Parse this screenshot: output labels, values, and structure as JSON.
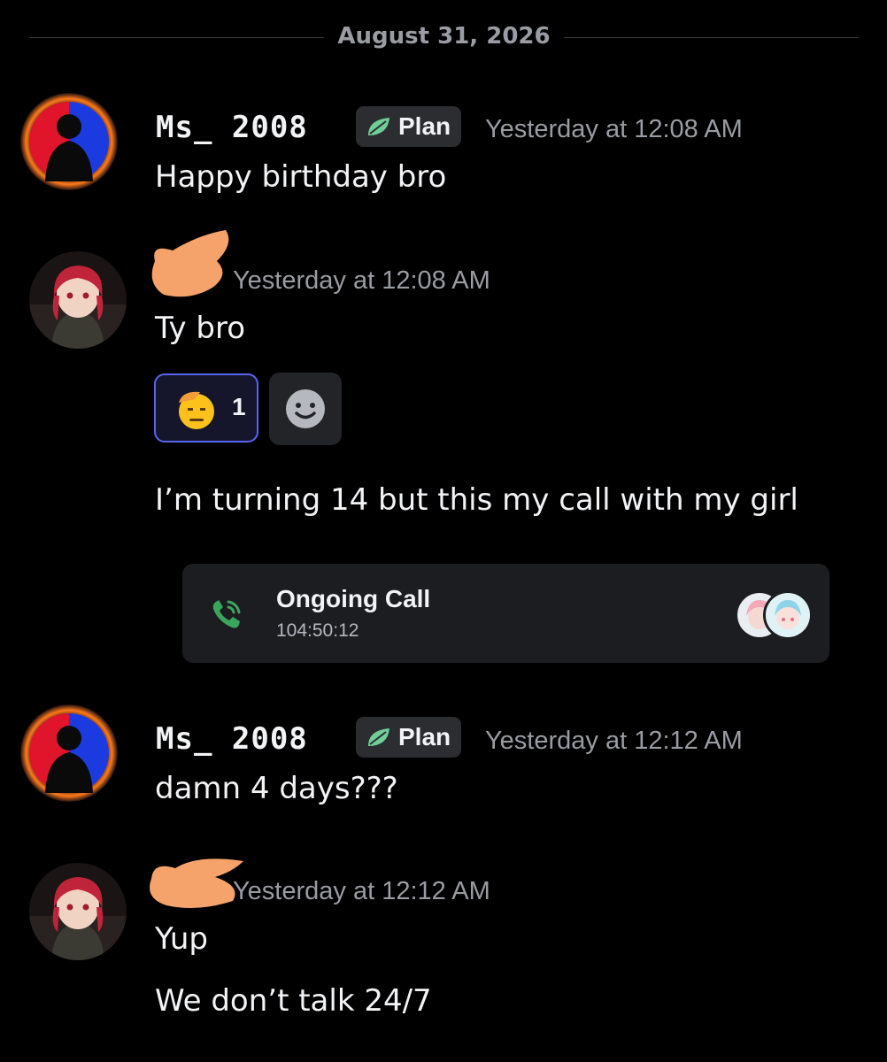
{
  "divider": {
    "date": "August 31, 2026"
  },
  "messages": [
    {
      "author": "Ms_ 2008",
      "tag": "Plan",
      "timestamp": "Yesterday at 12:08 AM",
      "lines": [
        "Happy birthday bro"
      ]
    },
    {
      "author": "",
      "timestamp": "Yesterday at 12:08 AM",
      "lines": [
        "Ty bro",
        "I’m turning 14 but this my call with my girl"
      ],
      "reaction": {
        "count": "1",
        "icon": "salute-emoji"
      },
      "call": {
        "title": "Ongoing Call",
        "duration": "104:50:12"
      }
    },
    {
      "author": "Ms_ 2008",
      "tag": "Plan",
      "timestamp": "Yesterday at 12:12 AM",
      "lines": [
        "damn 4 days???"
      ]
    },
    {
      "author": "",
      "timestamp": "Yesterday at 12:12 AM",
      "lines": [
        "Yup",
        "We don’t talk 24/7"
      ]
    }
  ],
  "colors": {
    "background": "#000000",
    "reaction_border": "#5865f2",
    "call_icon": "#3ba55d",
    "redaction": "#f5a36a",
    "tag_leaf": "#6fcf97"
  }
}
